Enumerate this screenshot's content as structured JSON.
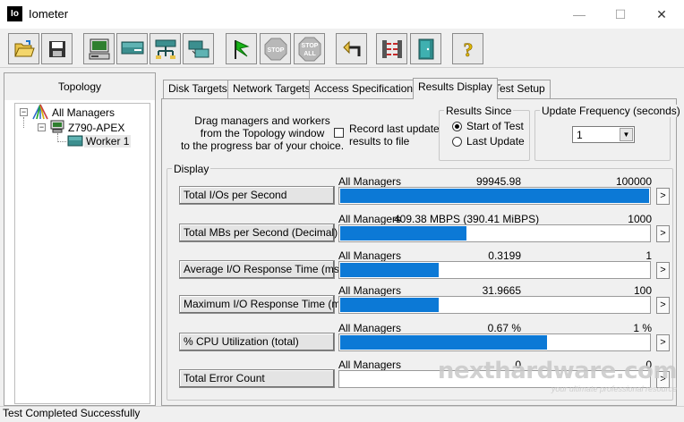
{
  "window": {
    "app_icon_text": "Io",
    "title": "Iometer",
    "minimize": "—",
    "maximize": "☐",
    "close": "✕"
  },
  "toolbar": {
    "buttons": [
      {
        "name": "open-config-button",
        "icon": "open-folder-icon"
      },
      {
        "name": "save-config-button",
        "icon": "floppy-disk-icon"
      },
      {
        "name": "start-disk-worker-button",
        "icon": "disk-worker-icon"
      },
      {
        "name": "start-network-worker-button",
        "icon": "network-worker-icon"
      },
      {
        "name": "add-manager-button",
        "icon": "network-icon"
      },
      {
        "name": "copy-worker-button",
        "icon": "copy-icon"
      },
      {
        "name": "start-tests-button",
        "icon": "green-flag-icon"
      },
      {
        "name": "stop-button",
        "icon": "stop-icon",
        "label": "STOP"
      },
      {
        "name": "stop-all-button",
        "icon": "stop-all-icon",
        "label_top": "STOP",
        "label_bottom": "ALL"
      },
      {
        "name": "reset-workers-button",
        "icon": "reset-arrow-icon"
      },
      {
        "name": "disconnect-button",
        "icon": "disconnect-icon"
      },
      {
        "name": "exit-button",
        "icon": "exit-door-icon"
      },
      {
        "name": "help-button",
        "icon": "help-icon",
        "label": "?"
      }
    ]
  },
  "topology": {
    "title": "Topology",
    "all_managers": "All Managers",
    "manager": "Z790-APEX",
    "worker": "Worker 1"
  },
  "tabs": [
    {
      "label": "Disk Targets",
      "active": false
    },
    {
      "label": "Network Targets",
      "active": false
    },
    {
      "label": "Access Specifications",
      "active": false
    },
    {
      "label": "Results Display",
      "active": true
    },
    {
      "label": "Test Setup",
      "active": false
    }
  ],
  "results": {
    "drag_hint": "Drag managers and workers\nfrom the Topology window\nto the progress bar of your choice.",
    "record_label": "Record last update\nresults to file",
    "record_checked": false,
    "results_since": {
      "title": "Results Since",
      "start_of_test": "Start of Test",
      "last_update": "Last Update",
      "selected": "start_of_test"
    },
    "update_frequency": {
      "title": "Update Frequency (seconds)",
      "value": "1"
    },
    "display_title": "Display"
  },
  "metrics": [
    {
      "label": "Total I/Os per Second",
      "source": "All Managers",
      "value": "99945.98",
      "max": "100000",
      "fraction": 0.9995
    },
    {
      "label": "Total MBs per Second (Decimal)",
      "source": "All Managers",
      "value": "409.38 MBPS (390.41 MiBPS)",
      "max": "1000",
      "fraction": 0.4094
    },
    {
      "label": "Average I/O Response Time (ms)",
      "source": "All Managers",
      "value": "0.3199",
      "max": "1",
      "fraction": 0.3199
    },
    {
      "label": "Maximum I/O Response Time (ms)",
      "source": "All Managers",
      "value": "31.9665",
      "max": "100",
      "fraction": 0.3197
    },
    {
      "label": "% CPU Utilization (total)",
      "source": "All Managers",
      "value": "0.67 %",
      "max": "1 %",
      "fraction": 0.67
    },
    {
      "label": "Total Error Count",
      "source": "All Managers",
      "value": "0",
      "max": "0",
      "fraction": 0
    }
  ],
  "metric_arrow": ">",
  "status": "Test Completed Successfully",
  "watermark": {
    "text": "nexthardware.com",
    "tagline": "your ultimate professional resource"
  },
  "colors": {
    "bar": "#0c79d6",
    "stop_red": "#c0392b"
  }
}
